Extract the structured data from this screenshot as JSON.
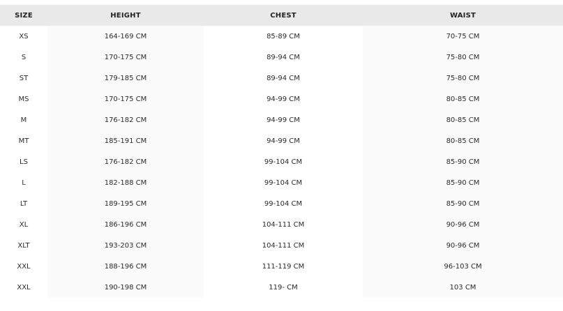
{
  "size_chart": {
    "headers": [
      "SIZE",
      "HEIGHT",
      "CHEST",
      "WAIST"
    ],
    "rows": [
      [
        "XS",
        "164-169 CM",
        "85-89 CM",
        "70-75 CM"
      ],
      [
        "S",
        "170-175 CM",
        "89-94 CM",
        "75-80 CM"
      ],
      [
        "ST",
        "179-185 CM",
        "89-94 CM",
        "75-80 CM"
      ],
      [
        "MS",
        "170-175 CM",
        "94-99 CM",
        "80-85 CM"
      ],
      [
        "M",
        "176-182 CM",
        "94-99 CM",
        "80-85 CM"
      ],
      [
        "MT",
        "185-191 CM",
        "94-99 CM",
        "80-85 CM"
      ],
      [
        "LS",
        "176-182 CM",
        "99-104 CM",
        "85-90 CM"
      ],
      [
        "L",
        "182-188 CM",
        "99-104 CM",
        "85-90 CM"
      ],
      [
        "LT",
        "189-195 CM",
        "99-104 CM",
        "85-90 CM"
      ],
      [
        "XL",
        "186-196 CM",
        "104-111 CM",
        "90-96 CM"
      ],
      [
        "XLT",
        "193-203 CM",
        "104-111 CM",
        "90-96 CM"
      ],
      [
        "XXL",
        "188-196 CM",
        "111-119 CM",
        "96-103 CM"
      ],
      [
        "XXL",
        "190-198 CM",
        "119- CM",
        "103 CM"
      ]
    ]
  },
  "colors": {
    "header_bg": "#e9e9e9",
    "alt_cell_bg": "#fbfbfb",
    "text": "#222222"
  }
}
